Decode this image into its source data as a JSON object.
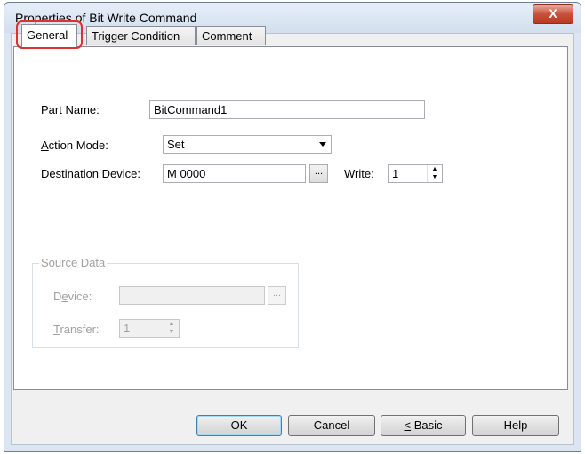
{
  "window": {
    "title": "Properties of Bit Write Command",
    "close_label": "X"
  },
  "tabs": [
    {
      "label": "General",
      "active": true
    },
    {
      "label": "Trigger Condition",
      "active": false
    },
    {
      "label": "Comment",
      "active": false
    }
  ],
  "general": {
    "part_name": {
      "label_mn": "P",
      "label_rest": "art Name:",
      "value": "BitCommand1"
    },
    "action_mode": {
      "label_mn": "A",
      "label_rest": "ction Mode:",
      "value": "Set"
    },
    "destination_device": {
      "label_pre": "Destination ",
      "label_mn": "D",
      "label_rest": "evice:",
      "value": "M 0000",
      "browse_label": "..."
    },
    "write": {
      "label_mn": "W",
      "label_rest": "rite:",
      "value": "1"
    }
  },
  "source_data": {
    "group_label": "Source Data",
    "device": {
      "label_pre": "D",
      "label_mn": "e",
      "label_rest": "vice:",
      "value": "",
      "browse_label": "..."
    },
    "transfer": {
      "label_mn": "T",
      "label_rest": "ransfer:",
      "value": "1"
    }
  },
  "buttons": {
    "ok": "OK",
    "cancel": "Cancel",
    "basic_mn": "<",
    "basic_rest": " Basic",
    "help": "Help"
  },
  "colors": {
    "highlight": "#e03030",
    "close_button": "#c8503a"
  }
}
